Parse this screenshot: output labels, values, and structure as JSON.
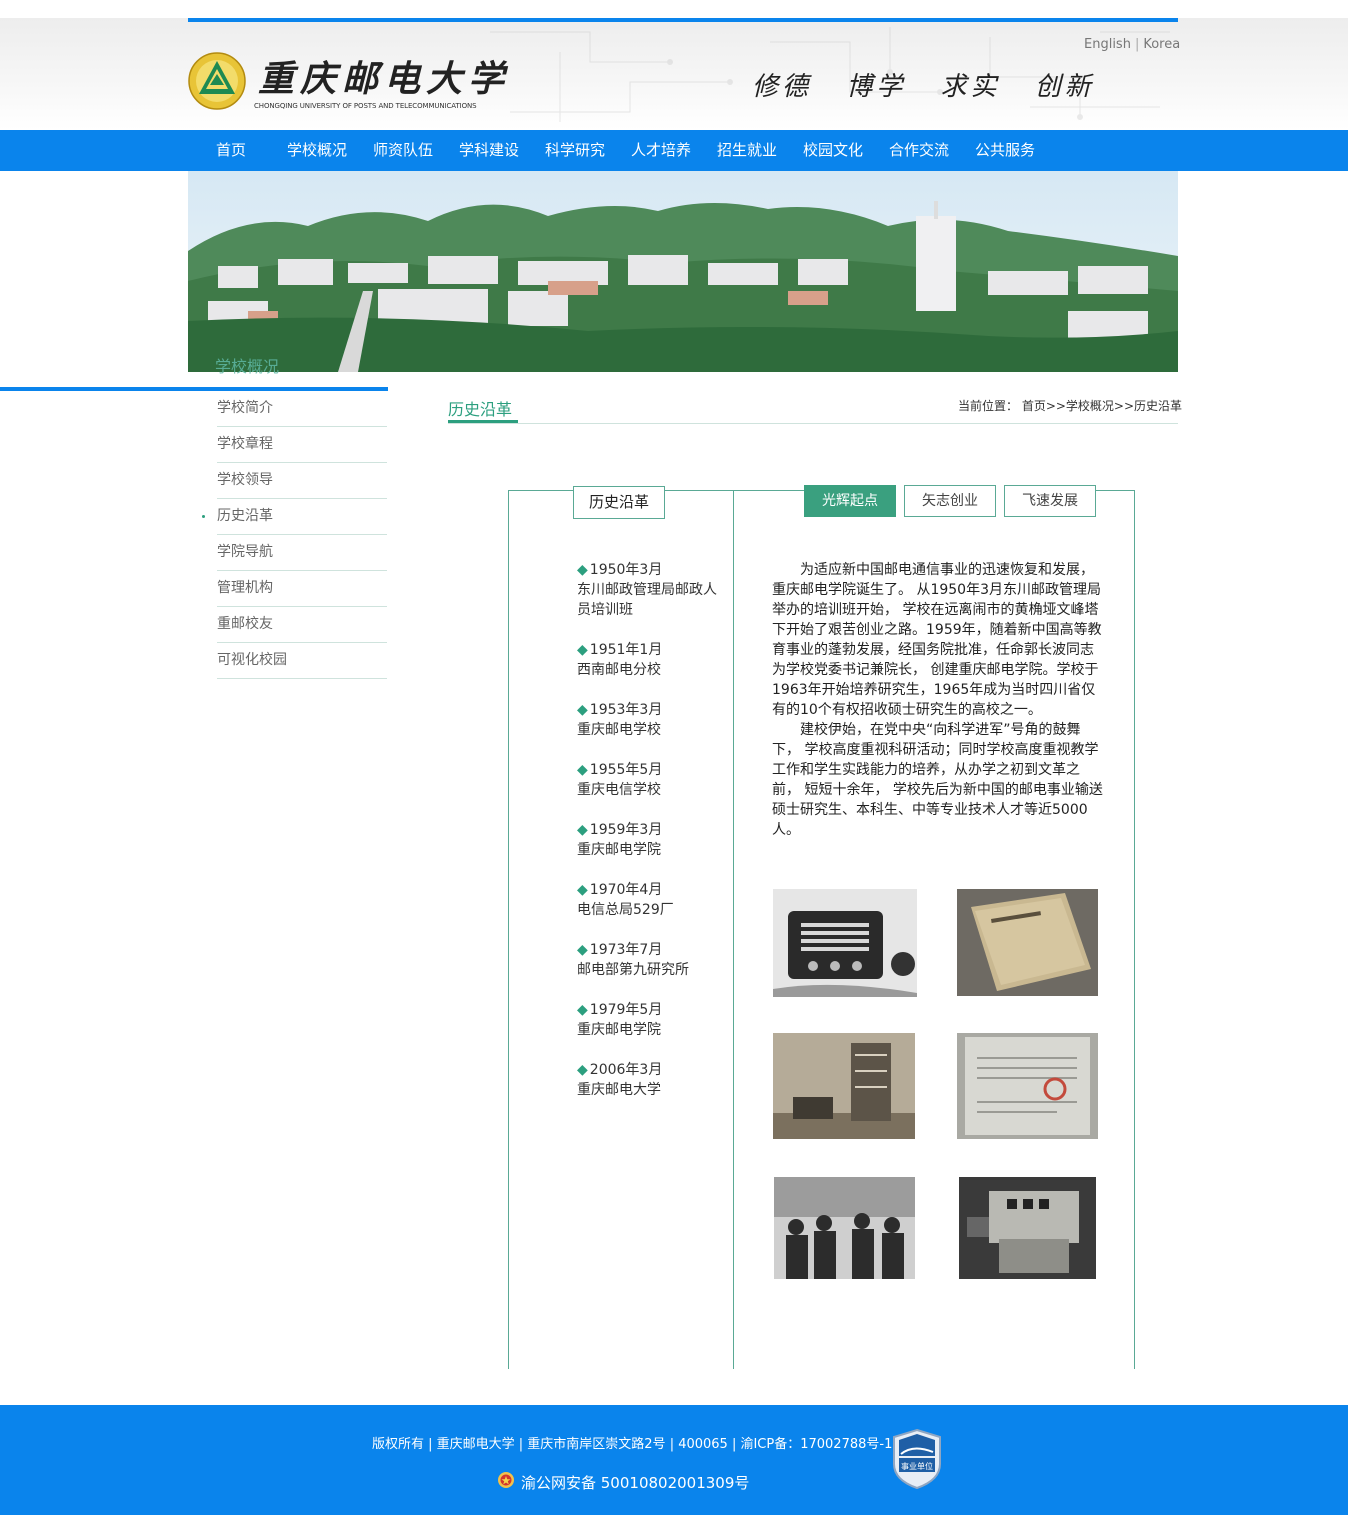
{
  "header": {
    "school_name": "重庆邮电大学",
    "school_name_en": "CHONGQING UNIVERSITY OF POSTS AND TELECOMMUNICATIONS",
    "lang_english": "English",
    "lang_sep": "|",
    "lang_korea": "Korea",
    "motto": "修德 博学 求实 创新"
  },
  "nav": {
    "items": [
      "首页",
      "学校概况",
      "师资队伍",
      "学科建设",
      "科学研究",
      "人才培养",
      "招生就业",
      "校园文化",
      "合作交流",
      "公共服务"
    ]
  },
  "banner": {
    "caption": "学校概况"
  },
  "sidebar": {
    "items": [
      "学校简介",
      "学校章程",
      "学校领导",
      "历史沿革",
      "学院导航",
      "管理机构",
      "重邮校友",
      "可视化校园"
    ],
    "active_index": 3
  },
  "content": {
    "title": "历史沿革",
    "breadcrumb": "当前位置：  首页>>学校概况>>历史沿革"
  },
  "history": {
    "box_label": "历史沿革",
    "tabs": [
      "光辉起点",
      "矢志创业",
      "飞速发展"
    ],
    "active_tab": 0,
    "timeline": [
      {
        "date": "1950年3月",
        "name": "东川邮政管理局邮政人员培训班"
      },
      {
        "date": "1951年1月",
        "name": "西南邮电分校"
      },
      {
        "date": "1953年3月",
        "name": "重庆邮电学校"
      },
      {
        "date": "1955年5月",
        "name": "重庆电信学校"
      },
      {
        "date": "1959年3月",
        "name": "重庆邮电学院"
      },
      {
        "date": "1970年4月",
        "name": "电信总局529厂"
      },
      {
        "date": "1973年7月",
        "name": "邮电部第九研究所"
      },
      {
        "date": "1979年5月",
        "name": "重庆邮电学院"
      },
      {
        "date": "2006年3月",
        "name": "重庆邮电大学"
      }
    ],
    "paragraph1": "为适应新中国邮电通信事业的迅速恢复和发展，重庆邮电学院诞生了。 从1950年3月东川邮政管理局举办的培训班开始， 学校在远离闹市的黄桷垭文峰塔下开始了艰苦创业之路。1959年，随着新中国高等教育事业的蓬勃发展，经国务院批准，任命郭长波同志为学校党委书记兼院长， 创建重庆邮电学院。学校于1963年开始培养研究生，1965年成为当时四川省仅有的10个有权招收硕士研究生的高校之一。",
    "paragraph2": "建校伊始，在党中央“向科学进军”号角的鼓舞下， 学校高度重视科研活动；同时学校高度重视教学工作和学生实践能力的培养，从办学之初到文革之前， 短短十余年， 学校先后为新中国的邮电事业输送硕士研究生、本科生、中等专业技术人才等近5000人。"
  },
  "footer": {
    "line1": "版权所有 | 重庆邮电大学 | 重庆市南岸区崇文路2号 | 400065 | 渝ICP备：17002788号-1",
    "line2": "渝公网安备 50010802001309号",
    "badge_text": "事业单位"
  },
  "colors": {
    "primary_blue": "#0a84ec",
    "accent_green": "#2c9f7f",
    "box_border": "#5aa995"
  }
}
